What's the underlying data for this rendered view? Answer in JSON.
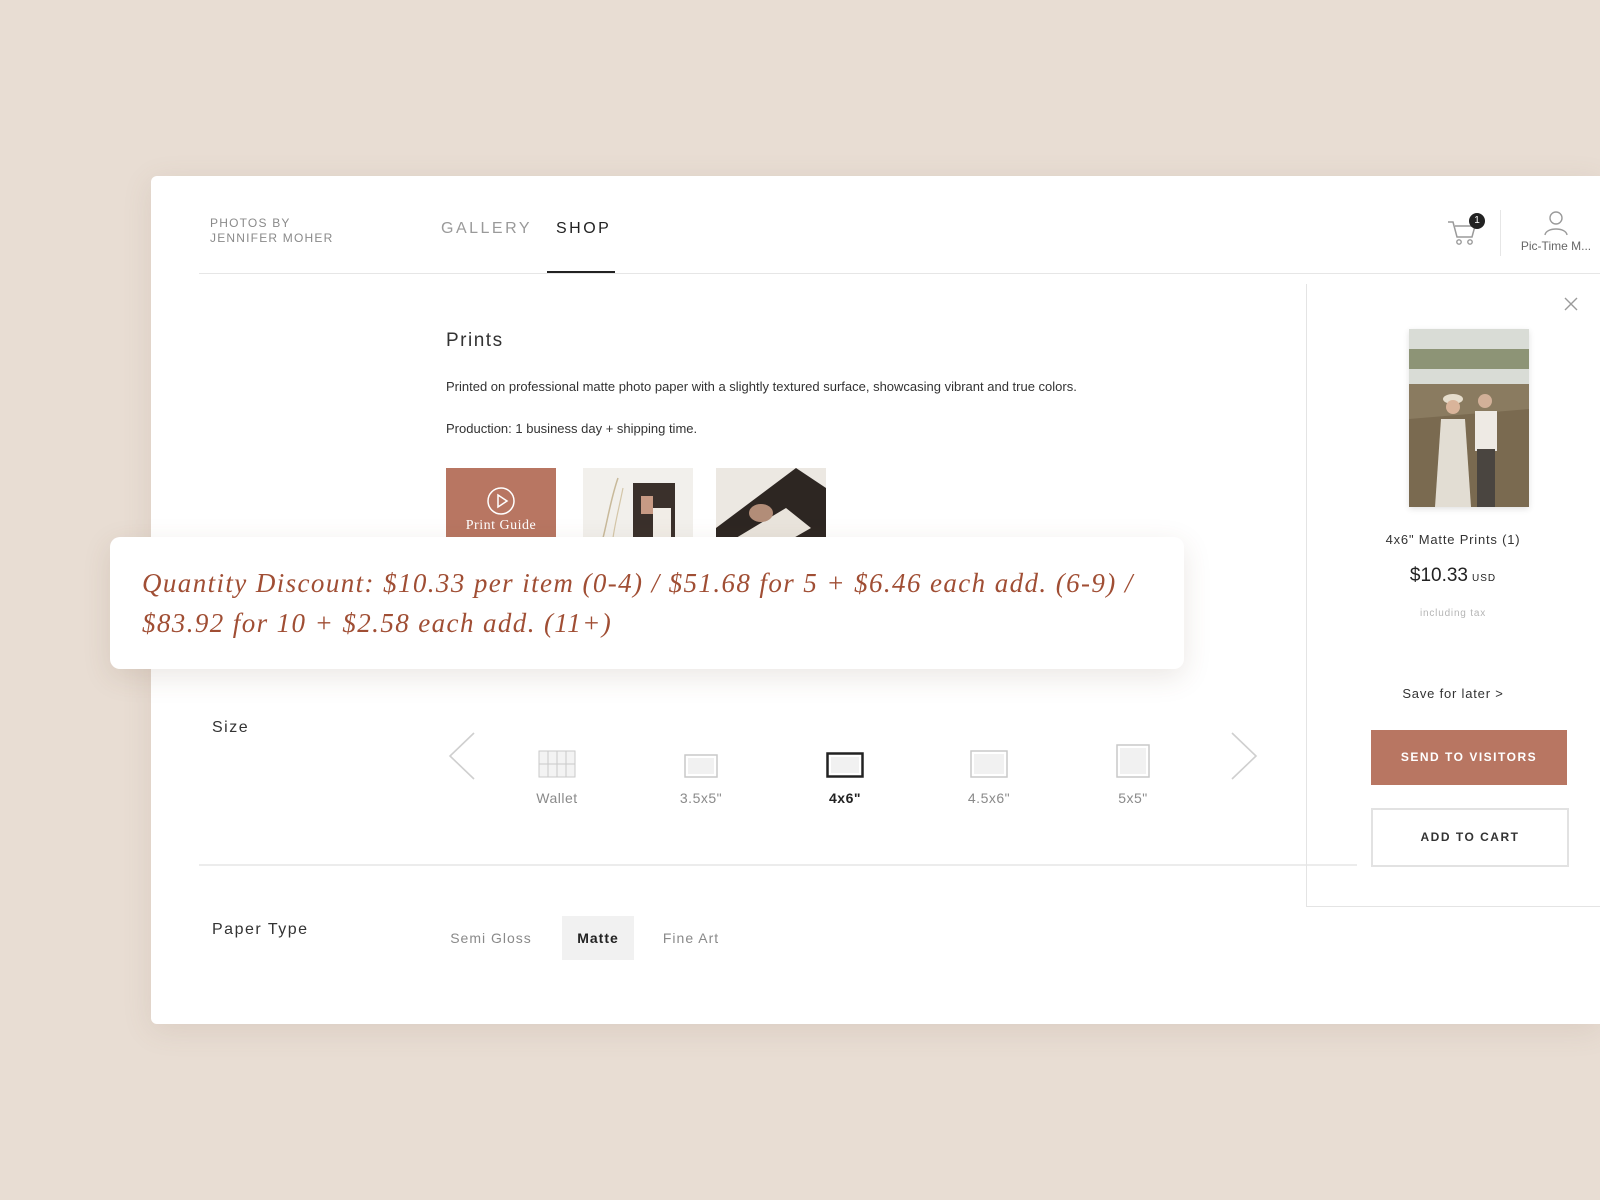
{
  "header": {
    "brand_line1": "PHOTOS BY",
    "brand_line2": "JENNIFER MOHER",
    "nav": [
      {
        "label": "GALLERY",
        "active": false
      },
      {
        "label": "SHOP",
        "active": true
      }
    ],
    "cart_count": "1",
    "user_label": "Pic-Time M..."
  },
  "product": {
    "title": "Prints",
    "description": "Printed on professional matte photo paper with a slightly textured surface, showcasing vibrant and true colors.",
    "production": "Production: 1 business day + shipping time.",
    "print_guide_label": "Print Guide"
  },
  "discount": {
    "text": "Quantity Discount: $10.33 per item (0-4)  /  $51.68 for 5 + $6.46 each add. (6-9)  /  $83.92 for 10 + $2.58 each add. (11+)"
  },
  "size": {
    "label": "Size",
    "options": [
      {
        "label": "Wallet",
        "active": false
      },
      {
        "label": "3.5x5\"",
        "active": false
      },
      {
        "label": "4x6\"",
        "active": true
      },
      {
        "label": "4.5x6\"",
        "active": false
      },
      {
        "label": "5x5\"",
        "active": false
      }
    ]
  },
  "paper": {
    "label": "Paper Type",
    "options": [
      {
        "label": "Semi Gloss",
        "active": false
      },
      {
        "label": "Matte",
        "active": true
      },
      {
        "label": "Fine Art",
        "active": false
      }
    ]
  },
  "panel": {
    "item_name": "4x6\" Matte Prints (1)",
    "price": "$10.33",
    "currency": "USD",
    "tax_note": "including tax",
    "save_later": "Save for later  >",
    "send_button": "SEND TO VISITORS",
    "cart_button": "ADD TO CART"
  },
  "colors": {
    "accent": "#b87662",
    "discount_text": "#a04e34",
    "background": "#e8ddd3"
  },
  "icons": [
    "cart-icon",
    "user-icon",
    "play-icon",
    "chevron-left-icon",
    "chevron-right-icon",
    "close-icon"
  ]
}
